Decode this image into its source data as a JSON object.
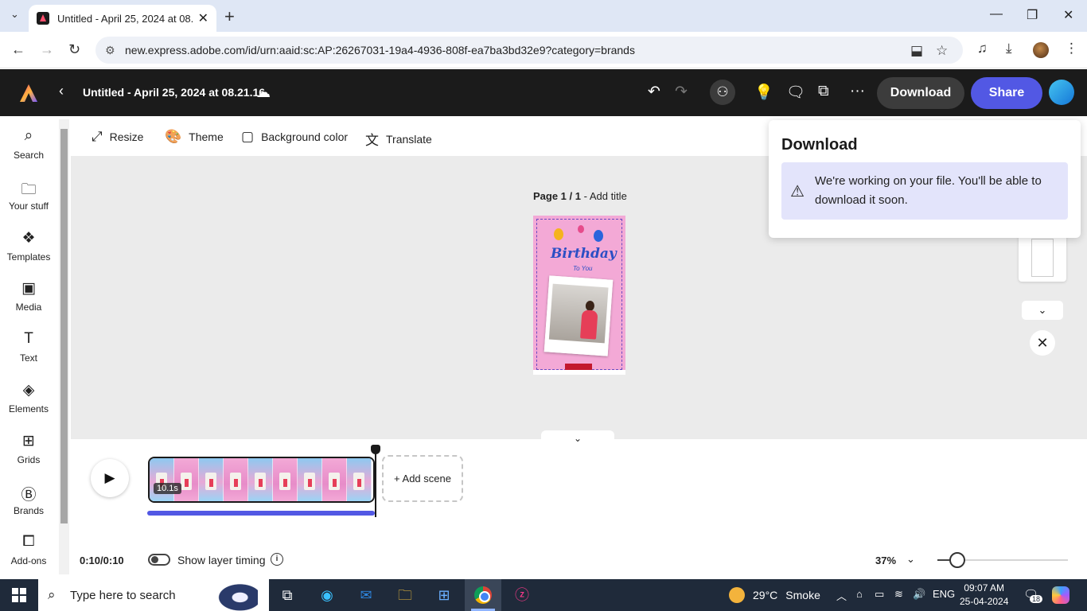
{
  "browser": {
    "tab_title": "Untitled - April 25, 2024 at 08.",
    "tab_close": "✕",
    "new_tab": "+",
    "url": "new.express.adobe.com/id/urn:aaid:sc:AP:26267031-19a4-4936-808f-ea7ba3bd32e9?category=brands"
  },
  "header": {
    "doc_title": "Untitled - April 25, 2024 at 08.21.16",
    "download_label": "Download",
    "share_label": "Share"
  },
  "rail": {
    "items": [
      {
        "label": "Search",
        "icon": "search-icon"
      },
      {
        "label": "Your stuff",
        "icon": "folder-icon"
      },
      {
        "label": "Templates",
        "icon": "templates-icon"
      },
      {
        "label": "Media",
        "icon": "media-icon"
      },
      {
        "label": "Text",
        "icon": "text-icon"
      },
      {
        "label": "Elements",
        "icon": "elements-icon"
      },
      {
        "label": "Grids",
        "icon": "grids-icon"
      },
      {
        "label": "Brands",
        "icon": "brands-icon"
      },
      {
        "label": "Add-ons",
        "icon": "addons-icon"
      }
    ]
  },
  "toolbar": {
    "resize": "Resize",
    "theme": "Theme",
    "background_color": "Background color",
    "translate": "Translate"
  },
  "canvas": {
    "page_label": "Page 1 / 1",
    "page_sep": " - ",
    "add_title": "Add title",
    "artboard_heading": "Birthday",
    "artboard_sub": "To You"
  },
  "popover": {
    "title": "Download",
    "message": "We're working on your file. You'll be able to download it soon."
  },
  "timeline": {
    "duration": "10.1s",
    "add_scene": "+ Add scene",
    "timecode": "0:10/0:10",
    "layer_timing": "Show layer timing",
    "zoom": "37%",
    "zoom_fraction": 0.15,
    "playback_progress": 1.0
  },
  "taskbar": {
    "search_placeholder": "Type here to search",
    "weather_temp": "29°C",
    "weather_desc": "Smoke",
    "lang": "ENG",
    "time": "09:07 AM",
    "date": "25-04-2024",
    "notif_count": "18"
  },
  "colors": {
    "accent": "#5258e4",
    "header_bg": "#1b1b1b",
    "info_bg": "#e3e4fb"
  }
}
